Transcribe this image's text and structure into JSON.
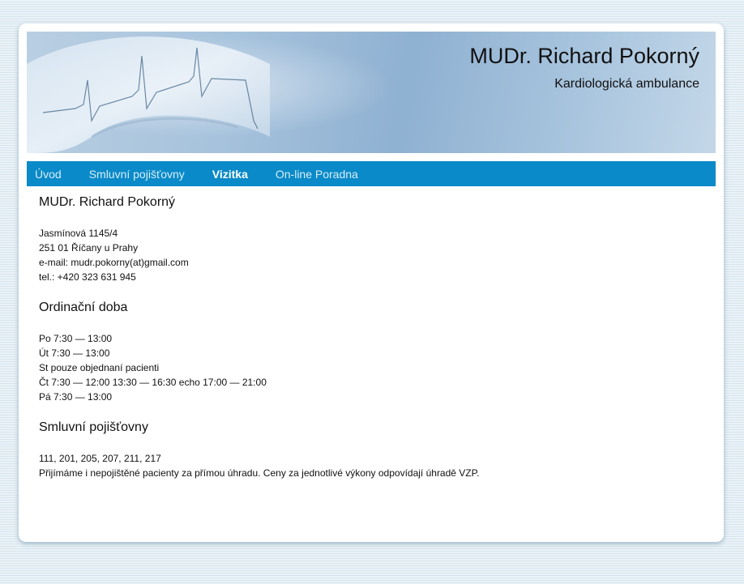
{
  "header": {
    "title": "MUDr. Richard Pokorný",
    "subtitle": "Kardiologická ambulance"
  },
  "nav": {
    "items": [
      {
        "label": "Úvod"
      },
      {
        "label": "Smluvní pojišťovny"
      },
      {
        "label": "Vizitka",
        "active": true
      },
      {
        "label": "On-line Poradna"
      }
    ]
  },
  "contact": {
    "heading": "MUDr. Richard Pokorný",
    "street": "Jasmínová 1145/4",
    "city": "251 01 Říčany u Prahy",
    "email": "e-mail: mudr.pokorny(at)gmail.com",
    "phone": "tel.: +420 323 631 945"
  },
  "hours": {
    "heading": "Ordinační doba",
    "lines": [
      "Po 7:30 — 13:00",
      "Út 7:30 — 13:00",
      "St pouze objednaní pacienti",
      "Čt 7:30 — 12:00 13:30 — 16:30 echo 17:00 — 21:00",
      "Pá 7:30 — 13:00"
    ]
  },
  "insurance": {
    "heading": "Smluvní pojišťovny",
    "codes": "111, 201, 205, 207, 211, 217",
    "note": "Přijímáme i nepojištěné pacienty za přímou úhradu. Ceny za jednotlivé výkony odpovídají úhradě VZP."
  },
  "colors": {
    "nav_bg": "#0a8ac8",
    "page_bg": "#ffffff"
  }
}
